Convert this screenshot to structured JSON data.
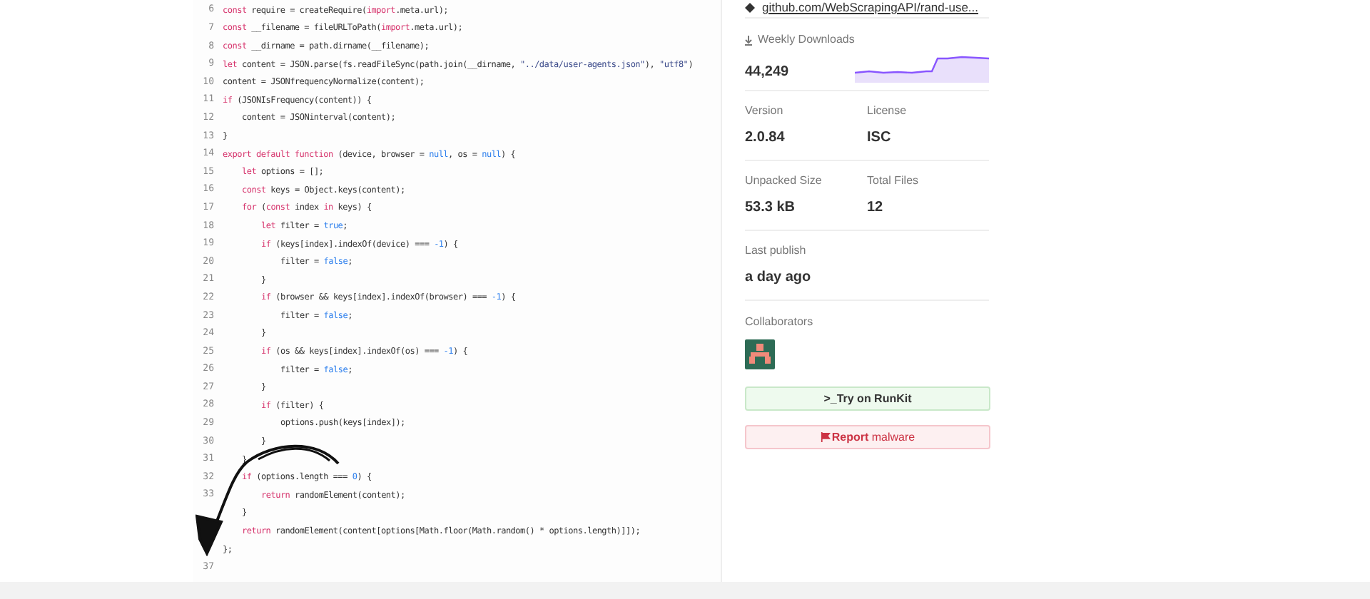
{
  "code": {
    "lines": [
      {
        "number": "6",
        "tokens": [
          {
            "kind": "kw",
            "text": "const"
          },
          {
            "kind": "txt",
            "text": " require = createRequire("
          },
          {
            "kind": "kw",
            "text": "import"
          },
          {
            "kind": "txt",
            "text": ".meta.url);"
          }
        ]
      },
      {
        "number": "7",
        "tokens": [
          {
            "kind": "kw",
            "text": "const"
          },
          {
            "kind": "txt",
            "text": " __filename = fileURLToPath("
          },
          {
            "kind": "kw",
            "text": "import"
          },
          {
            "kind": "txt",
            "text": ".meta.url);"
          }
        ]
      },
      {
        "number": "8",
        "tokens": [
          {
            "kind": "kw",
            "text": "const"
          },
          {
            "kind": "txt",
            "text": " __dirname = path.dirname(__filename);"
          }
        ]
      },
      {
        "number": "9",
        "tokens": [
          {
            "kind": "kw",
            "text": "let"
          },
          {
            "kind": "txt",
            "text": " content = JSON.parse(fs.readFileSync(path.join(__dirname, "
          },
          {
            "kind": "str",
            "text": "\"../data/user-agents.json\""
          },
          {
            "kind": "txt",
            "text": "), "
          },
          {
            "kind": "str",
            "text": "\"utf8\""
          },
          {
            "kind": "txt",
            "text": ")"
          }
        ]
      },
      {
        "number": "10",
        "tokens": [
          {
            "kind": "txt",
            "text": "content = JSONfrequencyNormalize(content);"
          }
        ]
      },
      {
        "number": "11",
        "tokens": [
          {
            "kind": "kw",
            "text": "if"
          },
          {
            "kind": "txt",
            "text": " (JSONIsFrequency(content)) {"
          }
        ],
        "children": [
          {
            "number": "12",
            "tokens": [
              {
                "kind": "txt",
                "text": "content = JSONinterval(content);"
              }
            ]
          }
        ]
      },
      {
        "number": "13",
        "tokens": [
          {
            "kind": "txt",
            "text": "}"
          }
        ]
      },
      {
        "number": "14",
        "tokens": [
          {
            "kind": "kw",
            "text": "export default function"
          },
          {
            "kind": "txt",
            "text": " (device, browser = "
          },
          {
            "kind": "lit",
            "text": "null"
          },
          {
            "kind": "txt",
            "text": ", os = "
          },
          {
            "kind": "lit",
            "text": "null"
          },
          {
            "kind": "txt",
            "text": ") {"
          }
        ],
        "children": [
          {
            "number": "15",
            "tokens": [
              {
                "kind": "kw",
                "text": "let"
              },
              {
                "kind": "txt",
                "text": " options = [];"
              }
            ]
          },
          {
            "number": "16",
            "tokens": [
              {
                "kind": "kw",
                "text": "const"
              },
              {
                "kind": "txt",
                "text": " keys = Object.keys(content);"
              }
            ]
          },
          {
            "number": "17",
            "tokens": [
              {
                "kind": "kw",
                "text": "for"
              },
              {
                "kind": "txt",
                "text": " ("
              },
              {
                "kind": "kw",
                "text": "const"
              },
              {
                "kind": "txt",
                "text": " index "
              },
              {
                "kind": "kw",
                "text": "in"
              },
              {
                "kind": "txt",
                "text": " keys) {"
              }
            ],
            "children": [
              {
                "number": "18",
                "tokens": [
                  {
                    "kind": "kw",
                    "text": "let"
                  },
                  {
                    "kind": "txt",
                    "text": " filter = "
                  },
                  {
                    "kind": "lit",
                    "text": "true"
                  },
                  {
                    "kind": "txt",
                    "text": ";"
                  }
                ]
              },
              {
                "number": "19",
                "tokens": [
                  {
                    "kind": "kw",
                    "text": "if"
                  },
                  {
                    "kind": "txt",
                    "text": " (keys[index].indexOf(device) === "
                  },
                  {
                    "kind": "lit",
                    "text": "-1"
                  },
                  {
                    "kind": "txt",
                    "text": ") {"
                  }
                ],
                "children": [
                  {
                    "number": "20",
                    "tokens": [
                      {
                        "kind": "txt",
                        "text": "filter = "
                      },
                      {
                        "kind": "lit",
                        "text": "false"
                      },
                      {
                        "kind": "txt",
                        "text": ";"
                      }
                    ]
                  }
                ]
              },
              {
                "number": "21",
                "tokens": [
                  {
                    "kind": "txt",
                    "text": "}"
                  }
                ]
              },
              {
                "number": "22",
                "tokens": [
                  {
                    "kind": "kw",
                    "text": "if"
                  },
                  {
                    "kind": "txt",
                    "text": " (browser && keys[index].indexOf(browser) === "
                  },
                  {
                    "kind": "lit",
                    "text": "-1"
                  },
                  {
                    "kind": "txt",
                    "text": ") {"
                  }
                ],
                "children": [
                  {
                    "number": "23",
                    "tokens": [
                      {
                        "kind": "txt",
                        "text": "filter = "
                      },
                      {
                        "kind": "lit",
                        "text": "false"
                      },
                      {
                        "kind": "txt",
                        "text": ";"
                      }
                    ]
                  }
                ]
              },
              {
                "number": "24",
                "tokens": [
                  {
                    "kind": "txt",
                    "text": "}"
                  }
                ]
              },
              {
                "number": "25",
                "tokens": [
                  {
                    "kind": "kw",
                    "text": "if"
                  },
                  {
                    "kind": "txt",
                    "text": " (os && keys[index].indexOf(os) === "
                  },
                  {
                    "kind": "lit",
                    "text": "-1"
                  },
                  {
                    "kind": "txt",
                    "text": ") {"
                  }
                ],
                "children": [
                  {
                    "number": "26",
                    "tokens": [
                      {
                        "kind": "txt",
                        "text": "filter = "
                      },
                      {
                        "kind": "lit",
                        "text": "false"
                      },
                      {
                        "kind": "txt",
                        "text": ";"
                      }
                    ]
                  }
                ]
              },
              {
                "number": "27",
                "tokens": [
                  {
                    "kind": "txt",
                    "text": "}"
                  }
                ]
              },
              {
                "number": "28",
                "tokens": [
                  {
                    "kind": "kw",
                    "text": "if"
                  },
                  {
                    "kind": "txt",
                    "text": " (filter) {"
                  }
                ],
                "children": [
                  {
                    "number": "29",
                    "tokens": [
                      {
                        "kind": "txt",
                        "text": "options.push(keys[index]);"
                      }
                    ]
                  }
                ]
              },
              {
                "number": "30",
                "tokens": [
                  {
                    "kind": "txt",
                    "text": "}"
                  }
                ]
              }
            ]
          },
          {
            "number": "31",
            "tokens": [
              {
                "kind": "txt",
                "text": "}"
              }
            ]
          },
          {
            "number": "32",
            "tokens": [
              {
                "kind": "kw",
                "text": "if"
              },
              {
                "kind": "txt",
                "text": " (options.length === "
              },
              {
                "kind": "lit",
                "text": "0"
              },
              {
                "kind": "txt",
                "text": ") {"
              }
            ],
            "children": [
              {
                "number": "33",
                "tokens": [
                  {
                    "kind": "kw",
                    "text": "return"
                  },
                  {
                    "kind": "txt",
                    "text": " randomElement(content);"
                  }
                ]
              }
            ]
          },
          {
            "tokens": [
              {
                "kind": "txt",
                "text": "}"
              }
            ]
          },
          {
            "tokens": [
              {
                "kind": "kw",
                "text": "return"
              },
              {
                "kind": "txt",
                "text": " randomElement(content[options[Math.floor(Math.random() * options.length)]]);"
              }
            ]
          }
        ]
      },
      {
        "tokens": [
          {
            "kind": "txt",
            "text": "};"
          }
        ]
      },
      {
        "number": "37"
      }
    ]
  },
  "sidebar": {
    "repository_link": "github.com/WebScrapingAPI/rand-use...",
    "weekly_downloads": {
      "label": "Weekly Downloads",
      "value": "44,249"
    },
    "stats": [
      [
        {
          "label": "Version",
          "value": "2.0.84"
        },
        {
          "label": "License",
          "value": "ISC"
        }
      ],
      [
        {
          "label": "Unpacked Size",
          "value": "53.3 kB"
        },
        {
          "label": "Total Files",
          "value": "12"
        }
      ],
      [
        {
          "label": "Last publish",
          "value": "a day ago"
        }
      ]
    ],
    "collaborators_label": "Collaborators",
    "buttons": [
      {
        "kind": "runkit",
        "prefix": ">_",
        "label": "Try on RunKit"
      },
      {
        "kind": "report",
        "prefix": "Report",
        "label": " malware"
      }
    ]
  }
}
